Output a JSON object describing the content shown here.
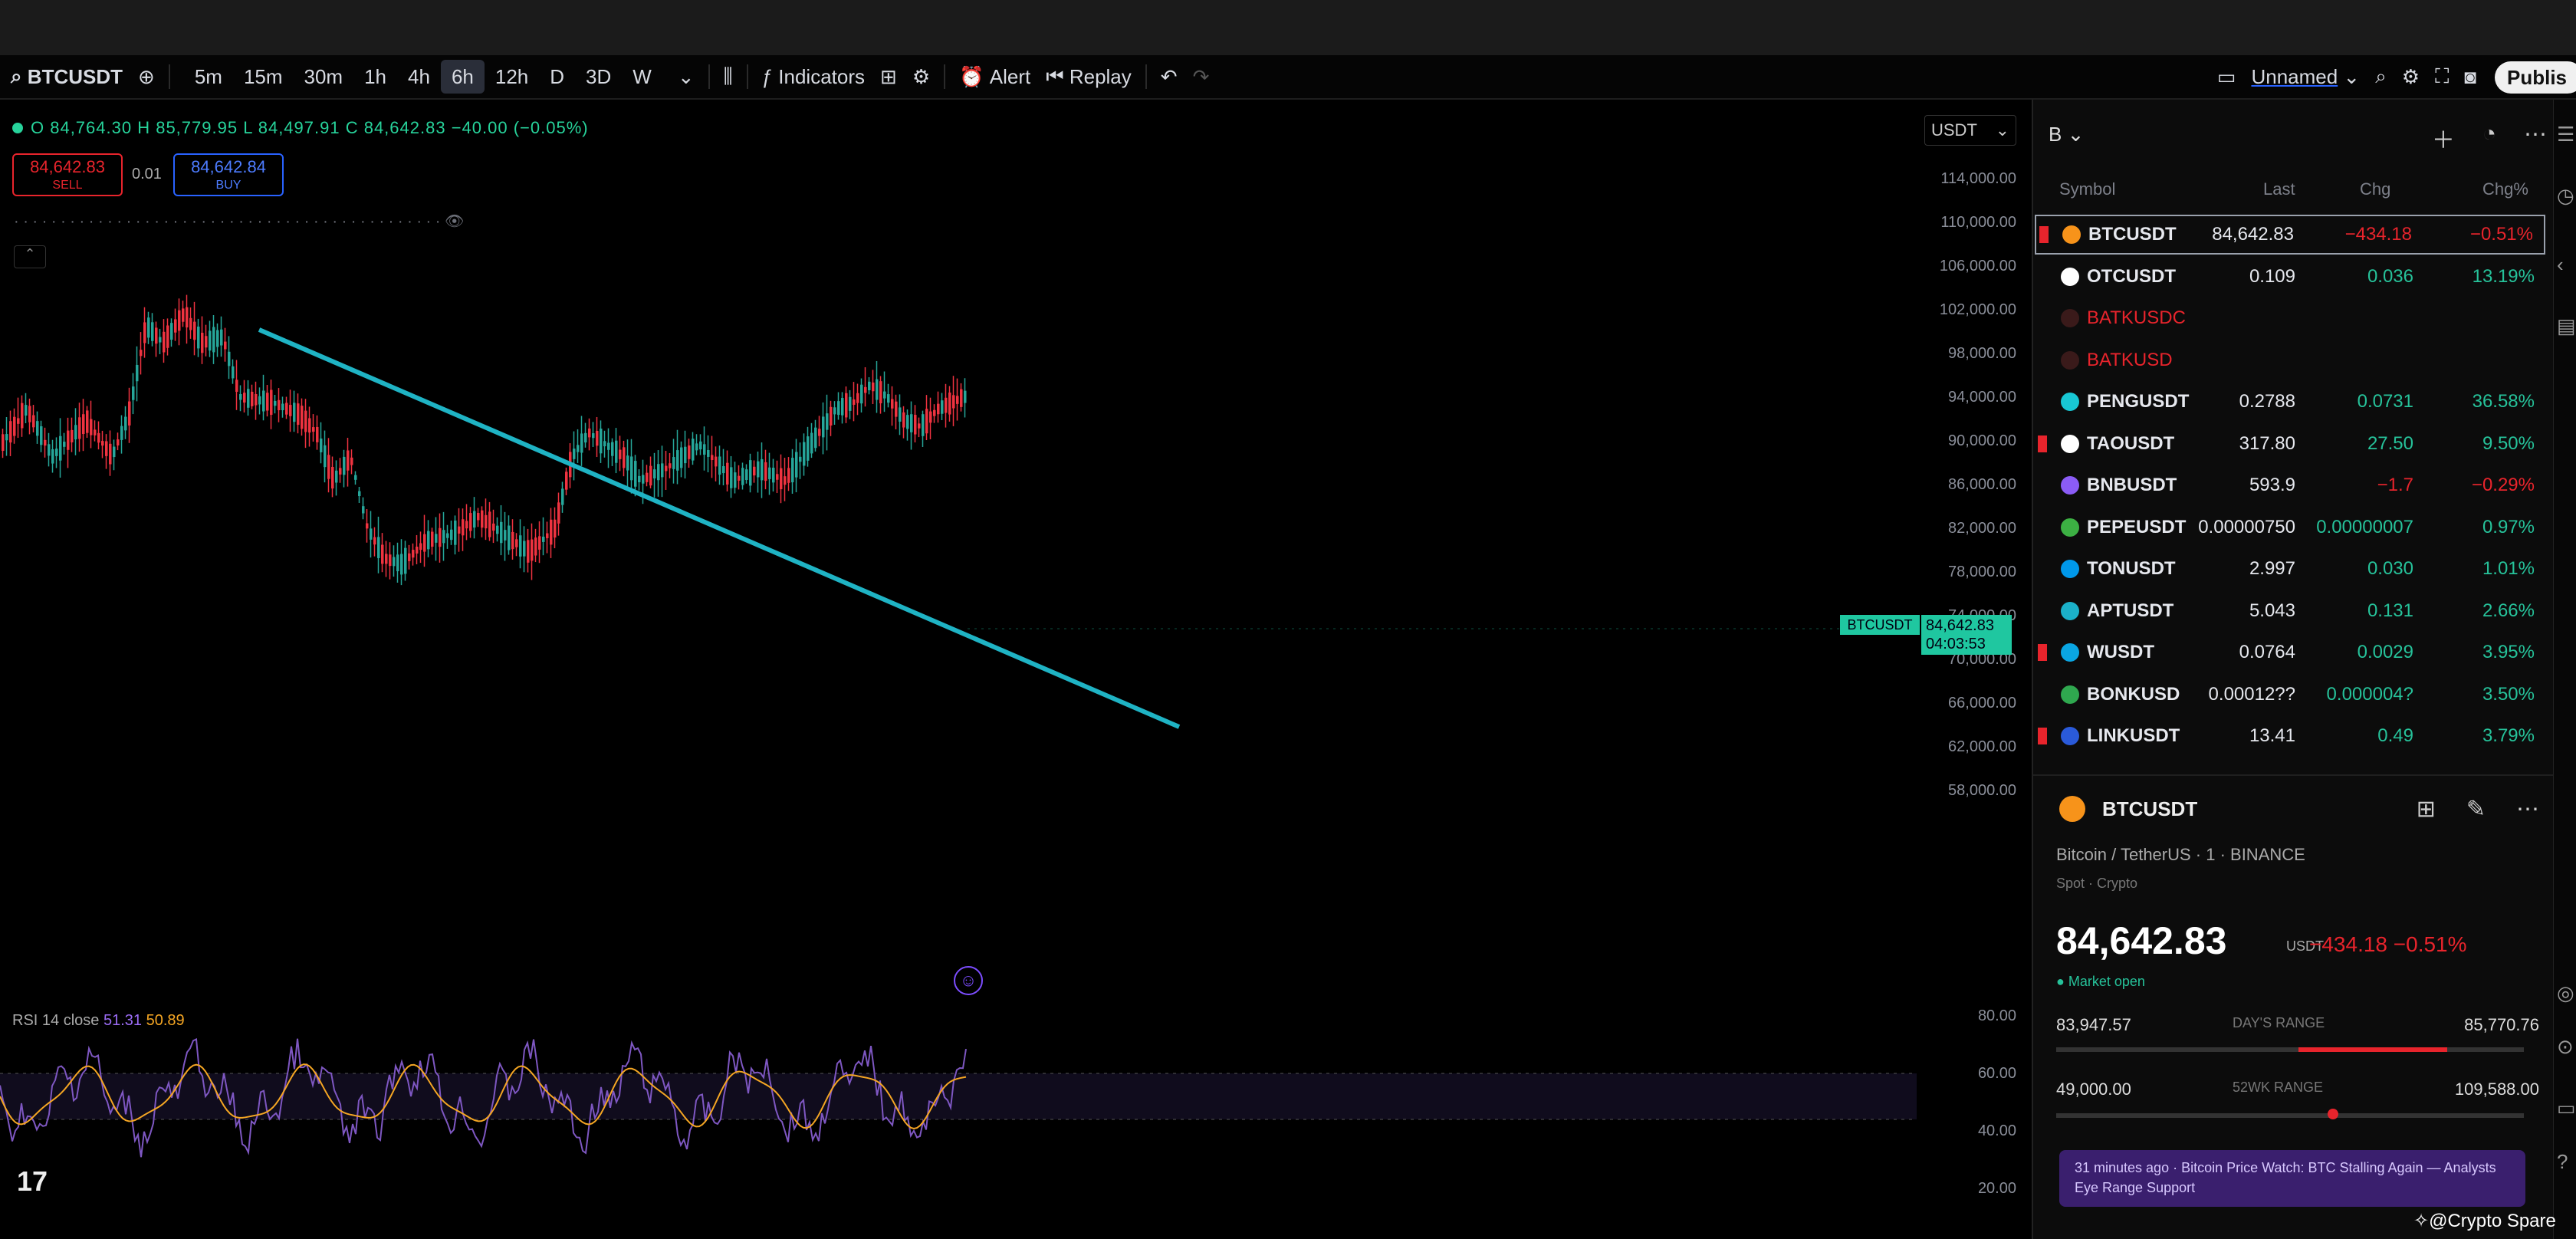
{
  "toolbar": {
    "symbol": "BTCUSDT",
    "intervals": [
      "5m",
      "15m",
      "30m",
      "1h",
      "4h",
      "6h",
      "12h",
      "D",
      "3D",
      "W"
    ],
    "active_interval": "6h",
    "indicators_label": "Indicators",
    "alert_label": "Alert",
    "replay_label": "Replay",
    "layout_label": "Unnamed",
    "publish_label": "Publis"
  },
  "legend": {
    "ohlc": "O 84,764.30 H 85,779.95 L 84,497.91 C 84,642.83 −40.00 (−0.05%)",
    "sell_price": "84,642.83",
    "sell_label": "SELL",
    "spread": "0.01",
    "buy_price": "84,642.84",
    "buy_label": "BUY",
    "rsi_label": "RSI 14 close",
    "rsi_value": "51.31",
    "rsi_ma": "50.89"
  },
  "price_axis": {
    "unit": "USDT",
    "ticks": [
      "114,000.00",
      "110,000.00",
      "106,000.00",
      "102,000.00",
      "98,000.00",
      "94,000.00",
      "90,000.00",
      "86,000.00",
      "82,000.00",
      "78,000.00",
      "74,000.00",
      "70,000.00",
      "66,000.00",
      "62,000.00",
      "58,000.00"
    ],
    "current_price": "84,642.83",
    "countdown": "04:03:53",
    "time_flag": "BTCUSDT",
    "rsi_ticks": [
      "80.00",
      "60.00",
      "40.00",
      "20.00"
    ]
  },
  "watchlist": {
    "name": "B",
    "columns": [
      "Symbol",
      "Last",
      "Chg",
      "Chg%"
    ],
    "rows": [
      {
        "flag": true,
        "icon_color": "#f7931a",
        "symbol": "BTCUSDT",
        "last": "84,642.83",
        "chg": "−434.18",
        "chgp": "−0.51%",
        "dir": "neg",
        "selected": true
      },
      {
        "flag": false,
        "icon_color": "#ffffff",
        "symbol": "OTCUSDT",
        "last": "0.109",
        "chg": "0.036",
        "chgp": "13.19%",
        "dir": "pos"
      },
      {
        "flag": false,
        "icon_color": "#3a1a1a",
        "symbol": "BATKUSDC",
        "last": "",
        "chg": "",
        "chgp": "",
        "dir": "red"
      },
      {
        "flag": false,
        "icon_color": "#3a1a1a",
        "symbol": "BATKUSD",
        "last": "",
        "chg": "",
        "chgp": "",
        "dir": "red"
      },
      {
        "flag": false,
        "icon_color": "#18c7d4",
        "symbol": "PENGUSDT",
        "last": "0.2788",
        "chg": "0.0731",
        "chgp": "36.58%",
        "dir": "pos"
      },
      {
        "flag": true,
        "icon_color": "#ffffff",
        "symbol": "TAOUSDT",
        "last": "317.80",
        "chg": "27.50",
        "chgp": "9.50%",
        "dir": "pos"
      },
      {
        "flag": false,
        "icon_color": "#8b5cf6",
        "symbol": "BNBUSDT",
        "last": "593.9",
        "chg": "−1.7",
        "chgp": "−0.29%",
        "dir": "neg"
      },
      {
        "flag": false,
        "icon_color": "#3cb043",
        "symbol": "PEPEUSDT",
        "last": "0.00000750",
        "chg": "0.00000007",
        "chgp": "0.97%",
        "dir": "pos"
      },
      {
        "flag": false,
        "icon_color": "#0098ea",
        "symbol": "TONUSDT",
        "last": "2.997",
        "chg": "0.030",
        "chgp": "1.01%",
        "dir": "pos"
      },
      {
        "flag": false,
        "icon_color": "#1bb1c9",
        "symbol": "APTUSDT",
        "last": "5.043",
        "chg": "0.131",
        "chgp": "2.66%",
        "dir": "pos"
      },
      {
        "flag": true,
        "icon_color": "#0aa6e3",
        "symbol": "WUSDT",
        "last": "0.0764",
        "chg": "0.0029",
        "chgp": "3.95%",
        "dir": "pos"
      },
      {
        "flag": false,
        "icon_color": "#2fa84f",
        "symbol": "BONKUSD",
        "last": "0.00012??",
        "chg": "0.000004?",
        "chgp": "3.50%",
        "dir": "pos"
      },
      {
        "flag": true,
        "icon_color": "#2a5ada",
        "symbol": "LINKUSDT",
        "last": "13.41",
        "chg": "0.49",
        "chgp": "3.79%",
        "dir": "pos"
      }
    ]
  },
  "details": {
    "symbol": "BTCUSDT",
    "description": "Bitcoin / TetherUS · 1 · BINANCE",
    "type": "Spot · Crypto",
    "price": "84,642.83",
    "unit": "USDT",
    "change": "−434.18  −0.51%",
    "market": "● Market open",
    "day_low": "83,947.57",
    "day_label": "DAY'S RANGE",
    "day_high": "85,770.76",
    "wk_low": "49,000.00",
    "wk_label": "52WK RANGE",
    "wk_high": "109,588.00",
    "news": "31 minutes ago · Bitcoin Price Watch: BTC Stalling Again — Analysts Eye Range Support"
  },
  "watermark": "✧@Crypto Spare",
  "chart_data": {
    "type": "line",
    "title": "",
    "series": [],
    "trendline": {
      "from": [
        1,
        107500
      ],
      "to": [
        7,
        78000
      ]
    },
    "ylim": [
      58000,
      114000
    ]
  }
}
